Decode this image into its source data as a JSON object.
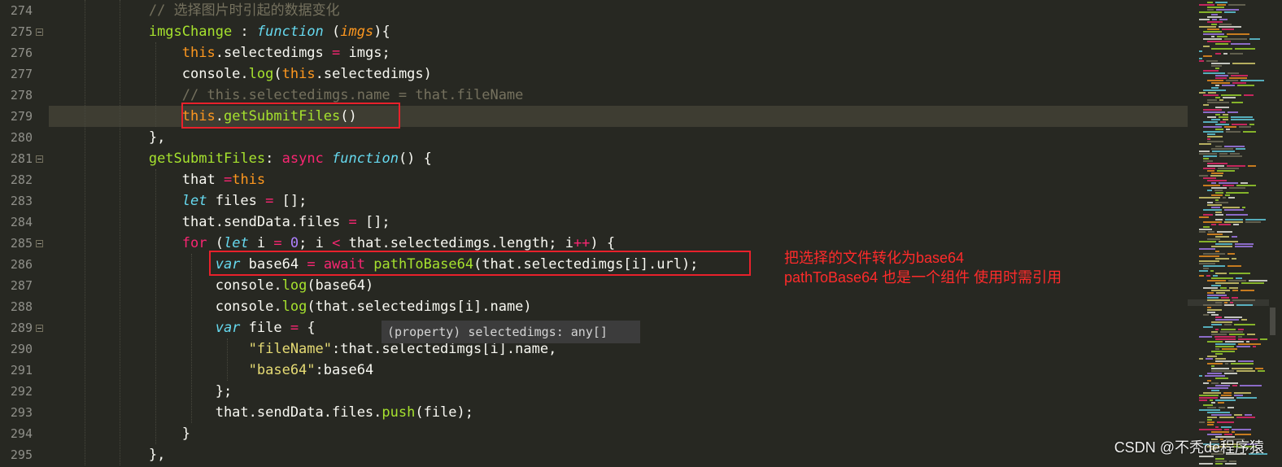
{
  "colors": {
    "background": "#272822",
    "active_line": "#3e3d32",
    "annotation_red": "#ff2b2b",
    "box_red": "#e8212b"
  },
  "editor": {
    "lines": [
      {
        "no": "274",
        "fold": false,
        "active": false,
        "tokens": [
          [
            "    ",
            "plain"
          ],
          [
            "    ",
            "plain"
          ],
          [
            "    ",
            "plain"
          ],
          [
            "// 选择图片时引起的数据变化",
            "comment"
          ]
        ]
      },
      {
        "no": "275",
        "fold": true,
        "active": false,
        "tokens": [
          [
            "            ",
            "plain"
          ],
          [
            "imgsChange",
            "func"
          ],
          [
            " : ",
            "plain"
          ],
          [
            "function",
            "storage"
          ],
          [
            " (",
            "plain"
          ],
          [
            "imgs",
            "param"
          ],
          [
            "){",
            "plain"
          ]
        ]
      },
      {
        "no": "276",
        "fold": false,
        "active": false,
        "tokens": [
          [
            "                ",
            "plain"
          ],
          [
            "this",
            "this"
          ],
          [
            ".selectedimgs ",
            "plain"
          ],
          [
            "=",
            "op"
          ],
          [
            " imgs;",
            "plain"
          ]
        ]
      },
      {
        "no": "277",
        "fold": false,
        "active": false,
        "tokens": [
          [
            "                ",
            "plain"
          ],
          [
            "console",
            "plain"
          ],
          [
            ".",
            "plain"
          ],
          [
            "log",
            "prop"
          ],
          [
            "(",
            "plain"
          ],
          [
            "this",
            "this"
          ],
          [
            ".selectedimgs)",
            "plain"
          ]
        ]
      },
      {
        "no": "278",
        "fold": false,
        "active": false,
        "tokens": [
          [
            "                ",
            "plain"
          ],
          [
            "// this.selectedimgs.name = that.fileName",
            "comment"
          ]
        ]
      },
      {
        "no": "279",
        "fold": false,
        "active": true,
        "tokens": [
          [
            "                ",
            "plain"
          ],
          [
            "this",
            "this"
          ],
          [
            ".",
            "plain"
          ],
          [
            "getSubmitFiles",
            "func"
          ],
          [
            "()",
            "plain"
          ]
        ]
      },
      {
        "no": "280",
        "fold": false,
        "active": false,
        "tokens": [
          [
            "            ",
            "plain"
          ],
          [
            "},",
            "plain"
          ]
        ]
      },
      {
        "no": "281",
        "fold": true,
        "active": false,
        "tokens": [
          [
            "            ",
            "plain"
          ],
          [
            "getSubmitFiles",
            "func"
          ],
          [
            ": ",
            "plain"
          ],
          [
            "async",
            "keyword"
          ],
          [
            " ",
            "plain"
          ],
          [
            "function",
            "storage"
          ],
          [
            "() {",
            "plain"
          ]
        ]
      },
      {
        "no": "282",
        "fold": false,
        "active": false,
        "tokens": [
          [
            "                ",
            "plain"
          ],
          [
            "that ",
            "plain"
          ],
          [
            "=",
            "op"
          ],
          [
            "this",
            "this"
          ]
        ]
      },
      {
        "no": "283",
        "fold": false,
        "active": false,
        "tokens": [
          [
            "                ",
            "plain"
          ],
          [
            "let",
            "storage"
          ],
          [
            " files ",
            "plain"
          ],
          [
            "=",
            "op"
          ],
          [
            " [];",
            "plain"
          ]
        ]
      },
      {
        "no": "284",
        "fold": false,
        "active": false,
        "tokens": [
          [
            "                ",
            "plain"
          ],
          [
            "that.sendData.files ",
            "plain"
          ],
          [
            "=",
            "op"
          ],
          [
            " [];",
            "plain"
          ]
        ]
      },
      {
        "no": "285",
        "fold": true,
        "active": false,
        "tokens": [
          [
            "                ",
            "plain"
          ],
          [
            "for",
            "keyword"
          ],
          [
            " (",
            "plain"
          ],
          [
            "let",
            "storage"
          ],
          [
            " i ",
            "plain"
          ],
          [
            "=",
            "op"
          ],
          [
            " ",
            "plain"
          ],
          [
            "0",
            "number"
          ],
          [
            "; i ",
            "plain"
          ],
          [
            "<",
            "op"
          ],
          [
            " that.selectedimgs.length; i",
            "plain"
          ],
          [
            "++",
            "op"
          ],
          [
            ") {",
            "plain"
          ]
        ]
      },
      {
        "no": "286",
        "fold": false,
        "active": false,
        "tokens": [
          [
            "                    ",
            "plain"
          ],
          [
            "var",
            "storage"
          ],
          [
            " base64 ",
            "plain"
          ],
          [
            "=",
            "op"
          ],
          [
            " ",
            "plain"
          ],
          [
            "await",
            "keyword"
          ],
          [
            " ",
            "plain"
          ],
          [
            "pathToBase64",
            "func"
          ],
          [
            "(that.selectedimgs[i].url);",
            "plain"
          ]
        ]
      },
      {
        "no": "287",
        "fold": false,
        "active": false,
        "tokens": [
          [
            "                    ",
            "plain"
          ],
          [
            "console.",
            "plain"
          ],
          [
            "log",
            "prop"
          ],
          [
            "(base64)",
            "plain"
          ]
        ]
      },
      {
        "no": "288",
        "fold": false,
        "active": false,
        "tokens": [
          [
            "                    ",
            "plain"
          ],
          [
            "console.",
            "plain"
          ],
          [
            "log",
            "prop"
          ],
          [
            "(that.selectedimgs[i].name)",
            "plain"
          ]
        ]
      },
      {
        "no": "289",
        "fold": true,
        "active": false,
        "tokens": [
          [
            "                    ",
            "plain"
          ],
          [
            "var",
            "storage"
          ],
          [
            " file ",
            "plain"
          ],
          [
            "=",
            "op"
          ],
          [
            " {",
            "plain"
          ]
        ]
      },
      {
        "no": "290",
        "fold": false,
        "active": false,
        "tokens": [
          [
            "                        ",
            "plain"
          ],
          [
            "\"fileName\"",
            "string"
          ],
          [
            ":that.selectedimgs[i].name,",
            "plain"
          ]
        ]
      },
      {
        "no": "291",
        "fold": false,
        "active": false,
        "tokens": [
          [
            "                        ",
            "plain"
          ],
          [
            "\"base64\"",
            "string"
          ],
          [
            ":base64",
            "plain"
          ]
        ]
      },
      {
        "no": "292",
        "fold": false,
        "active": false,
        "tokens": [
          [
            "                    ",
            "plain"
          ],
          [
            "};",
            "plain"
          ]
        ]
      },
      {
        "no": "293",
        "fold": false,
        "active": false,
        "tokens": [
          [
            "                    ",
            "plain"
          ],
          [
            "that.sendData.files.",
            "plain"
          ],
          [
            "push",
            "prop"
          ],
          [
            "(file);",
            "plain"
          ]
        ]
      },
      {
        "no": "294",
        "fold": false,
        "active": false,
        "tokens": [
          [
            "                ",
            "plain"
          ],
          [
            "}",
            "plain"
          ]
        ]
      },
      {
        "no": "295",
        "fold": false,
        "active": false,
        "tokens": [
          [
            "            ",
            "plain"
          ],
          [
            "},",
            "plain"
          ]
        ]
      }
    ]
  },
  "tooltip": {
    "text": "(property) selectedimgs: any[]"
  },
  "annotation": {
    "line1": "把选择的文件转化为base64",
    "line2": "pathToBase64 也是一个组件 使用时需引用"
  },
  "watermark": {
    "text": "CSDN @不秃de程序猿"
  }
}
